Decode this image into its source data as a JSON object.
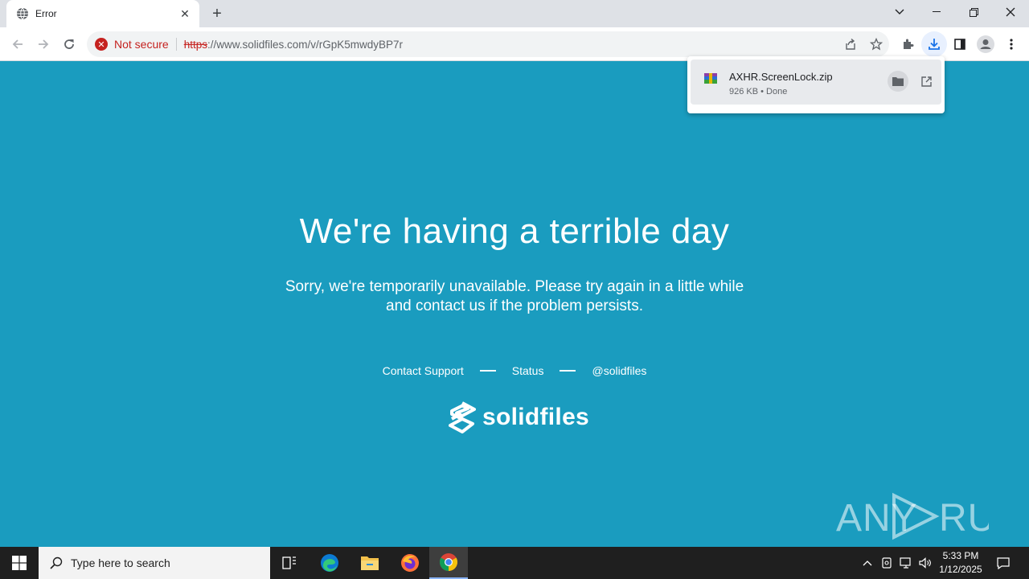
{
  "browser": {
    "tab_title": "Error",
    "new_tab_label": "+",
    "security_label": "Not secure",
    "url_scheme": "https",
    "url_rest": "://www.solidfiles.com/v/rGpK5mwdyBP7r"
  },
  "download": {
    "filename": "AXHR.ScreenLock.zip",
    "status": "926 KB • Done"
  },
  "page": {
    "heading": "We're having a terrible day",
    "subtitle_line1": "Sorry, we're temporarily unavailable. Please try again in a little while",
    "subtitle_line2": "and contact us if the problem persists.",
    "link_support": "Contact Support",
    "link_status": "Status",
    "link_twitter": "@solidfiles",
    "logo_text": "solidfiles",
    "background_color": "#1a9cbf"
  },
  "watermark": {
    "text": "ANY RUN"
  },
  "taskbar": {
    "search_placeholder": "Type here to search",
    "time": "5:33 PM",
    "date": "1/12/2025"
  }
}
